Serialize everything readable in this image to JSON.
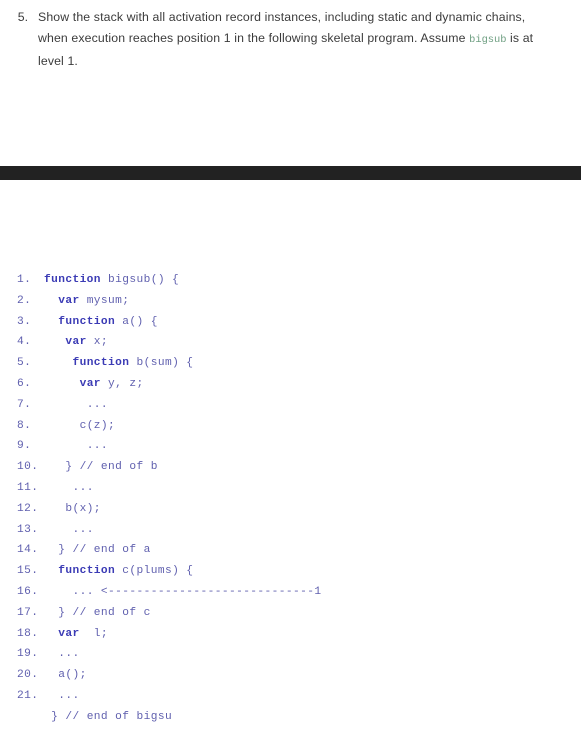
{
  "question": {
    "number": "5.",
    "lines": [
      "Show the stack with all activation record instances, including static and dynamic chains,",
      "when execution reaches position 1 in the following skeletal program. Assume ",
      "level 1."
    ],
    "line2_before": "when execution reaches position 1 in the following skeletal program. Assume ",
    "inline_code": "bigsub",
    "line2_after": " is at",
    "inline_code_color": "#6f9f82",
    "text_color": "#3b3b3b"
  },
  "divider": {
    "color": "#222222",
    "label": "section-divider-band"
  },
  "code_block": {
    "keyword_color": "#3b3bb5",
    "text_color": "#5f5fae",
    "lines": [
      {
        "num": "1.",
        "indent": "",
        "keyword": "function",
        "rest": " bigsub() {"
      },
      {
        "num": "2.",
        "indent": "  ",
        "keyword": "var",
        "rest": " mysum;"
      },
      {
        "num": "3.",
        "indent": "  ",
        "keyword": "function",
        "rest": " a() {"
      },
      {
        "num": "4.",
        "indent": "   ",
        "keyword": "var",
        "rest": " x;"
      },
      {
        "num": "5.",
        "indent": "    ",
        "keyword": "function",
        "rest": " b(sum) {"
      },
      {
        "num": "6.",
        "indent": "     ",
        "keyword": "var",
        "rest": " y, z;"
      },
      {
        "num": "7.",
        "indent": "      ",
        "keyword": "",
        "rest": "..."
      },
      {
        "num": "8.",
        "indent": "     ",
        "keyword": "",
        "rest": "c(z);"
      },
      {
        "num": "9.",
        "indent": "      ",
        "keyword": "",
        "rest": "..."
      },
      {
        "num": "10.",
        "indent": "   ",
        "keyword": "",
        "rest": "} // end of b"
      },
      {
        "num": "11.",
        "indent": "    ",
        "keyword": "",
        "rest": "..."
      },
      {
        "num": "12.",
        "indent": "   ",
        "keyword": "",
        "rest": "b(x);"
      },
      {
        "num": "13.",
        "indent": "    ",
        "keyword": "",
        "rest": "..."
      },
      {
        "num": "14.",
        "indent": "  ",
        "keyword": "",
        "rest": "} // end of a"
      },
      {
        "num": "15.",
        "indent": "  ",
        "keyword": "function",
        "rest": " c(plums) {"
      },
      {
        "num": "16.",
        "indent": "    ",
        "keyword": "",
        "rest": "... <-----------------------------1"
      },
      {
        "num": "17.",
        "indent": "  ",
        "keyword": "",
        "rest": "} // end of c"
      },
      {
        "num": "18.",
        "indent": "  ",
        "keyword": "var",
        "rest": "  l;"
      },
      {
        "num": "19.",
        "indent": "  ",
        "keyword": "",
        "rest": "..."
      },
      {
        "num": "20.",
        "indent": "  ",
        "keyword": "",
        "rest": "a();"
      },
      {
        "num": "21.",
        "indent": "  ",
        "keyword": "",
        "rest": "..."
      },
      {
        "num": "",
        "indent": " ",
        "keyword": "",
        "rest": "} // end of bigsu"
      }
    ]
  }
}
